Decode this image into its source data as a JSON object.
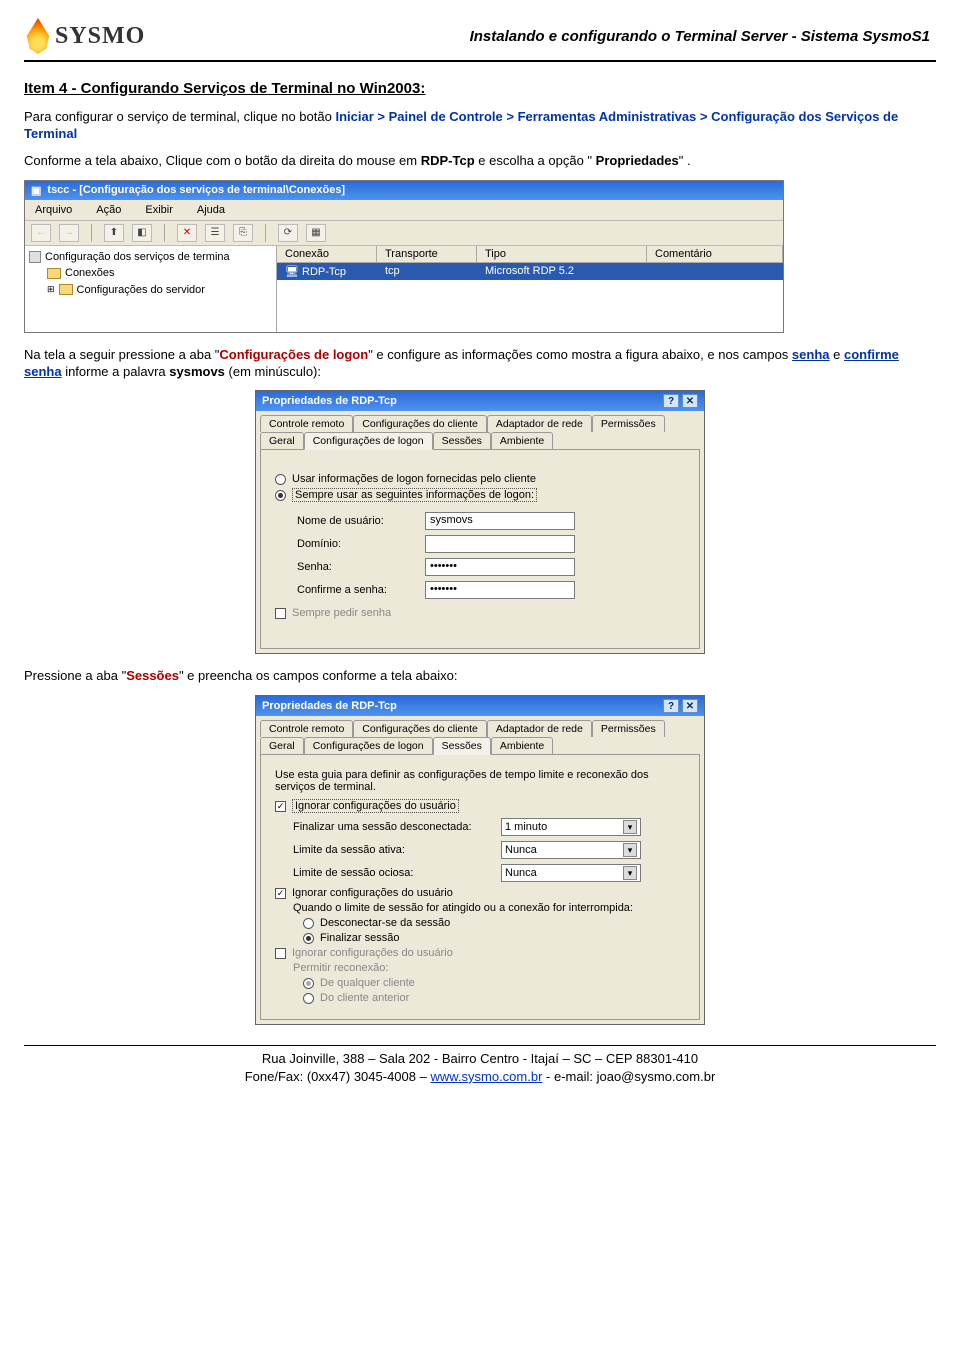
{
  "header": {
    "logo_text": "SYSMO",
    "doc_title": "Instalando e configurando o Terminal Server  - Sistema SysmoS1"
  },
  "section": {
    "heading": "Item 4 - Configurando Serviços de Terminal no Win2003:",
    "p1_a": "Para configurar o serviço de terminal, clique no botão ",
    "p1_iniciar": "Iniciar",
    "p1_gt1": " > ",
    "p1_painel": "Painel de Controle",
    "p1_gt2": "> ",
    "p1_ferr": "Ferramentas Administrativas",
    "p1_gt3": " > ",
    "p1_conf": "Configuração dos Serviços de Terminal",
    "p2_a": "Conforme a tela abaixo, Clique com o botão da direita do mouse em ",
    "p2_rdp": "RDP-Tcp",
    "p2_b": " e escolha a opção \"",
    "p2_prop": "Propriedades",
    "p2_c": "."
  },
  "tscc": {
    "title": "tscc - [Configuração dos serviços de terminal\\Conexões]",
    "menu": [
      "Arquivo",
      "Ação",
      "Exibir",
      "Ajuda"
    ],
    "tree": {
      "root": "Configuração dos serviços de termina",
      "n1": "Conexões",
      "n2": "Configurações do servidor"
    },
    "cols": {
      "c1": "Conexão",
      "c2": "Transporte",
      "c3": "Tipo",
      "c4": "Comentário"
    },
    "row": {
      "c1": "RDP-Tcp",
      "c2": "tcp",
      "c3": "Microsoft RDP 5.2",
      "c4": ""
    }
  },
  "mid": {
    "a": "Na tela a seguir pressione a aba \"",
    "b": "Configurações de logon",
    "c": "\" e configure as informações como mostra a figura abaixo, e nos campos ",
    "senha": "senha",
    "d": " e ",
    "conf": "confirme senha",
    "e": " informe a palavra ",
    "pw": "sysmovs",
    "f": " (em minúsculo):"
  },
  "dlg1": {
    "title": "Propriedades de RDP-Tcp",
    "tabs_back": [
      "Controle remoto",
      "Configurações do cliente",
      "Adaptador de rede",
      "Permissões"
    ],
    "tabs_front": {
      "t1": "Geral",
      "t2_active": "Configurações de logon",
      "t3": "Sessões",
      "t4": "Ambiente"
    },
    "radio1": "Usar informações de logon fornecidas pelo cliente",
    "radio2": "Sempre usar as seguintes informações de logon:",
    "f_user_l": "Nome de usuário:",
    "f_user_v": "sysmovs",
    "f_dom_l": "Domínio:",
    "f_dom_v": "",
    "f_pw_l": "Senha:",
    "f_pw_v": "•••••••",
    "f_cpw_l": "Confirme a senha:",
    "f_cpw_v": "•••••••",
    "chk": "Sempre pedir senha"
  },
  "mid2": {
    "a": "Pressione a aba \"",
    "b": "Sessões",
    "c": "\" e preencha os campos conforme a tela abaixo:"
  },
  "dlg2": {
    "title": "Propriedades de RDP-Tcp",
    "tabs_back": [
      "Controle remoto",
      "Configurações do cliente",
      "Adaptador de rede",
      "Permissões"
    ],
    "tabs_front": {
      "t1": "Geral",
      "t2": "Configurações de logon",
      "t3_active": "Sessões",
      "t4": "Ambiente"
    },
    "intro": "Use esta guia para definir as configurações de tempo limite e reconexão dos serviços de terminal.",
    "chk1": "Ignorar configurações do usuário",
    "f1_l": "Finalizar uma sessão desconectada:",
    "f1_v": "1 minuto",
    "f2_l": "Limite da sessão ativa:",
    "f2_v": "Nunca",
    "f3_l": "Limite de sessão ociosa:",
    "f3_v": "Nunca",
    "chk2": "Ignorar configurações do usuário",
    "sub_intro": "Quando o limite de sessão for atingido ou a conexão for interrompida:",
    "r1": "Desconectar-se da sessão",
    "r2": "Finalizar sessão",
    "chk3": "Ignorar configurações do usuário",
    "perm_l": "Permitir reconexão:",
    "perm_r1": "De qualquer cliente",
    "perm_r2": "Do cliente anterior"
  },
  "footer": {
    "l1": "Rua Joinville, 388 – Sala 202 - Bairro Centro - Itajaí – SC – CEP 88301-410",
    "l2a": "Fone/Fax: (0xx47) 3045-4008 – ",
    "l2link": "www.sysmo.com.br",
    "l2b": " - e-mail: joao@sysmo.com.br"
  }
}
